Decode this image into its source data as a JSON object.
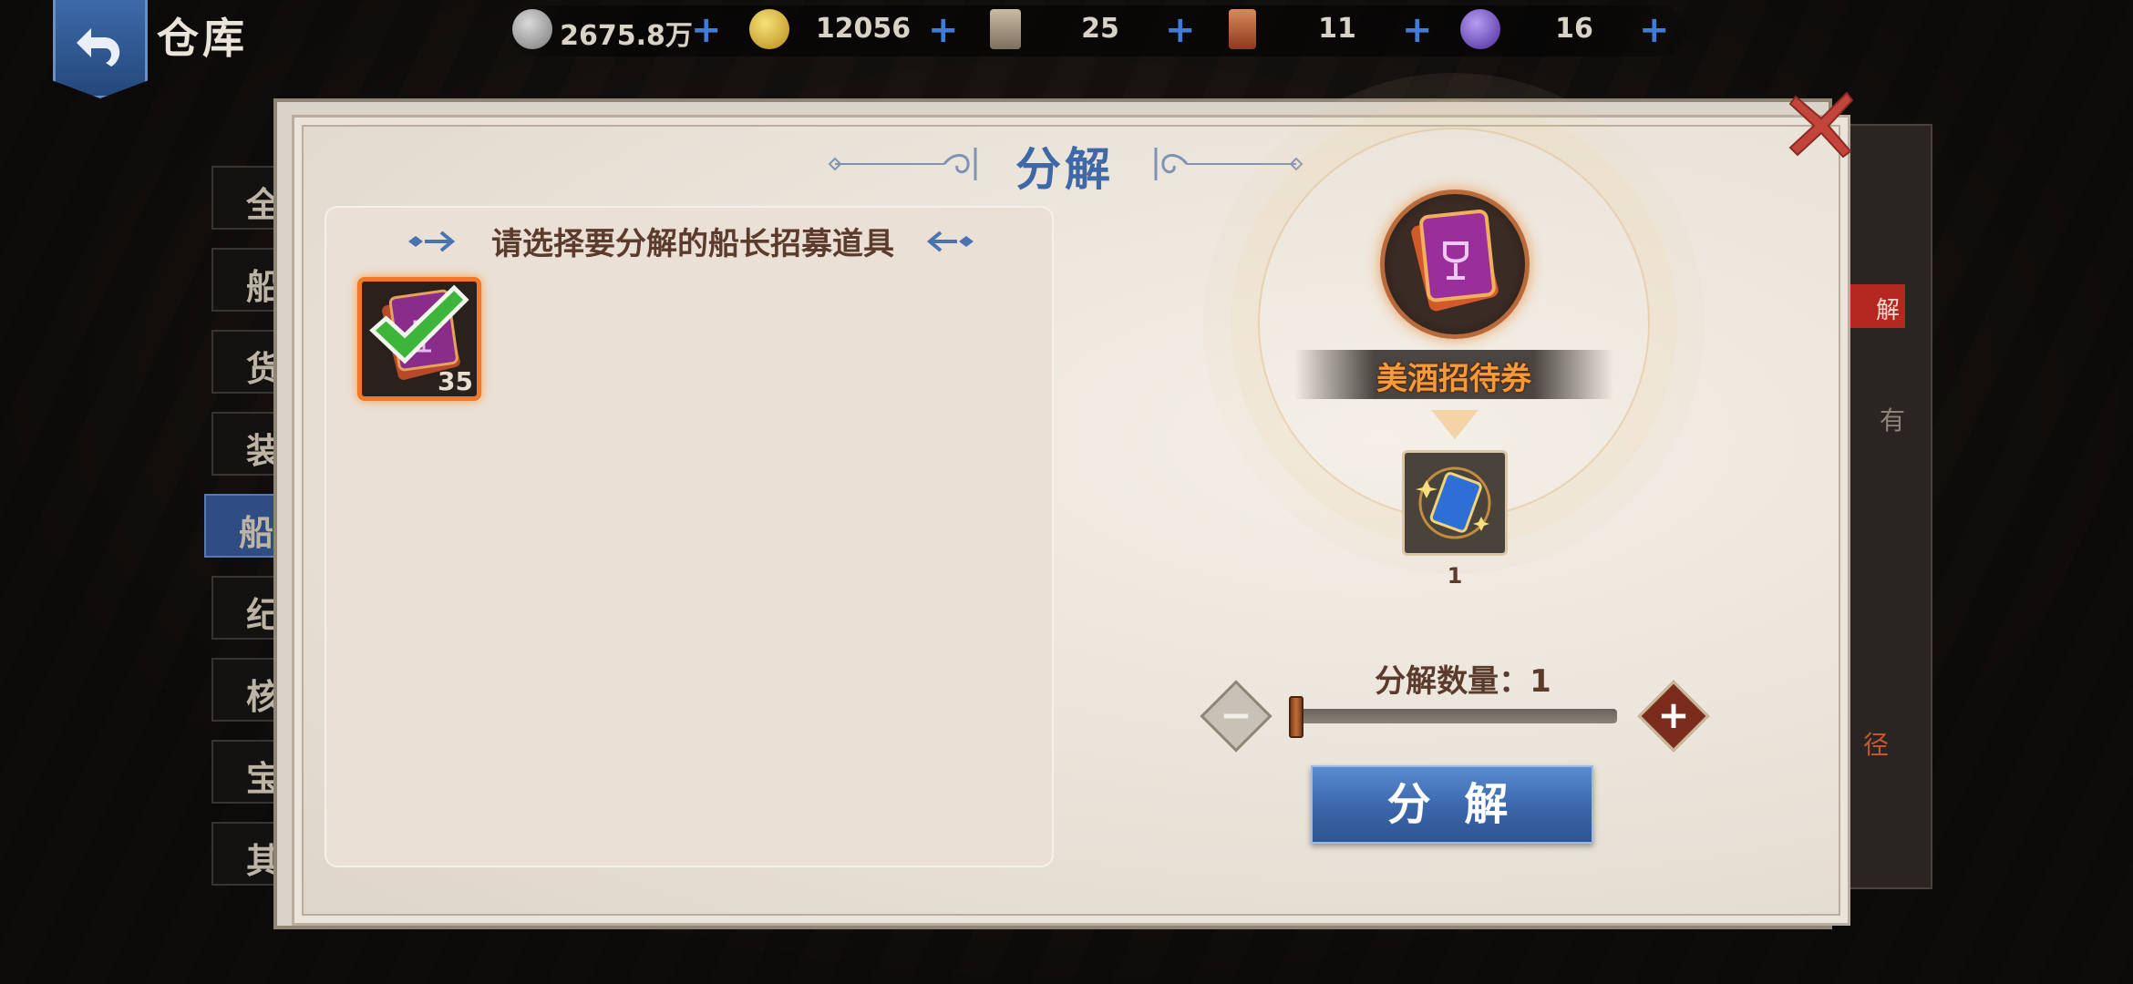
{
  "header": {
    "title": "仓库",
    "resources": [
      {
        "icon": "silver-coin-icon",
        "value": "2675.8万"
      },
      {
        "icon": "gold-coin-icon",
        "value": "12056"
      },
      {
        "icon": "scroll-icon",
        "value": "25"
      },
      {
        "icon": "map-ticket-icon",
        "value": "11"
      },
      {
        "icon": "purple-gem-icon",
        "value": "16"
      }
    ]
  },
  "background": {
    "category_tabs": [
      "全",
      "船",
      "货",
      "装",
      "船",
      "纪",
      "核",
      "宝",
      "其"
    ],
    "side_button": "解",
    "side_texts": [
      "有",
      "径"
    ]
  },
  "dialog": {
    "title": "分解",
    "list_header": "请选择要分解的船长招募道具",
    "items": [
      {
        "name": "美酒招待券",
        "count": "35",
        "selected": true
      }
    ],
    "selected_item_name": "美酒招待券",
    "reward": {
      "count": "1"
    },
    "quantity_label": "分解数量：1",
    "quantity": 1,
    "decompose_button": "分 解"
  },
  "colors": {
    "title_blue": "#3f68a6",
    "accent_orange": "#f07a2a",
    "button_blue": "#3a66aa",
    "brown_text": "#5a3b2c"
  }
}
